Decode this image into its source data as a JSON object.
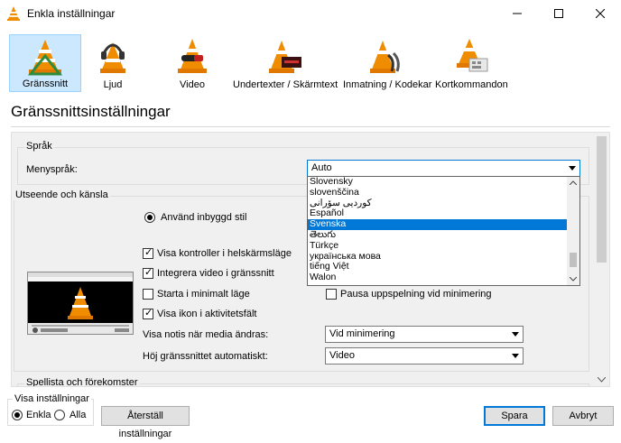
{
  "window": {
    "title": "Enkla inställningar"
  },
  "toolbar": {
    "items": [
      {
        "label": "Gränssnitt"
      },
      {
        "label": "Ljud"
      },
      {
        "label": "Video"
      },
      {
        "label": "Undertexter / Skärmtext"
      },
      {
        "label": "Inmatning / Kodekar"
      },
      {
        "label": "Kortkommandon"
      }
    ]
  },
  "page_title": "Gränssnittsinställningar",
  "language_group": {
    "title": "Språk",
    "menu_language_label": "Menyspråk:",
    "menu_language_value": "Auto",
    "options": [
      "Slovensky",
      "slovenščina",
      "کوردیی سۆرانی",
      "Español",
      "Svenska",
      "తెలుగు",
      "Türkçe",
      "українська мова",
      "tiếng Việt",
      "Walon"
    ],
    "selected_option": "Svenska"
  },
  "look_group": {
    "title": "Utseende och känsla",
    "builtin_style_label": "Använd inbyggd stil",
    "checkboxes": [
      {
        "label": "Visa kontroller i helskärmsläge",
        "checked": true
      },
      {
        "label": "Integrera video i gränssnitt",
        "checked": true
      },
      {
        "label": "Starta i minimalt läge",
        "checked": false
      },
      {
        "label": "Visa ikon i aktivitetsfält",
        "checked": true
      }
    ],
    "pause_label": "Pausa uppspelning vid minimering",
    "pause_checked": false,
    "notify_label": "Visa notis när media ändras:",
    "notify_value": "Vid minimering",
    "raise_label": "Höj gränssnittet automatiskt:",
    "raise_value": "Video"
  },
  "playlist_group": {
    "title": "Spellista och förekomster"
  },
  "footer": {
    "show_settings_label": "Visa inställningar",
    "simple_label": "Enkla",
    "all_label": "Alla",
    "reset_label": "Återställ inställningar",
    "save_label": "Spara",
    "cancel_label": "Avbryt"
  },
  "colors": {
    "accent": "#0078d7",
    "cone_orange": "#f08c00",
    "selection": "#cce8ff"
  }
}
